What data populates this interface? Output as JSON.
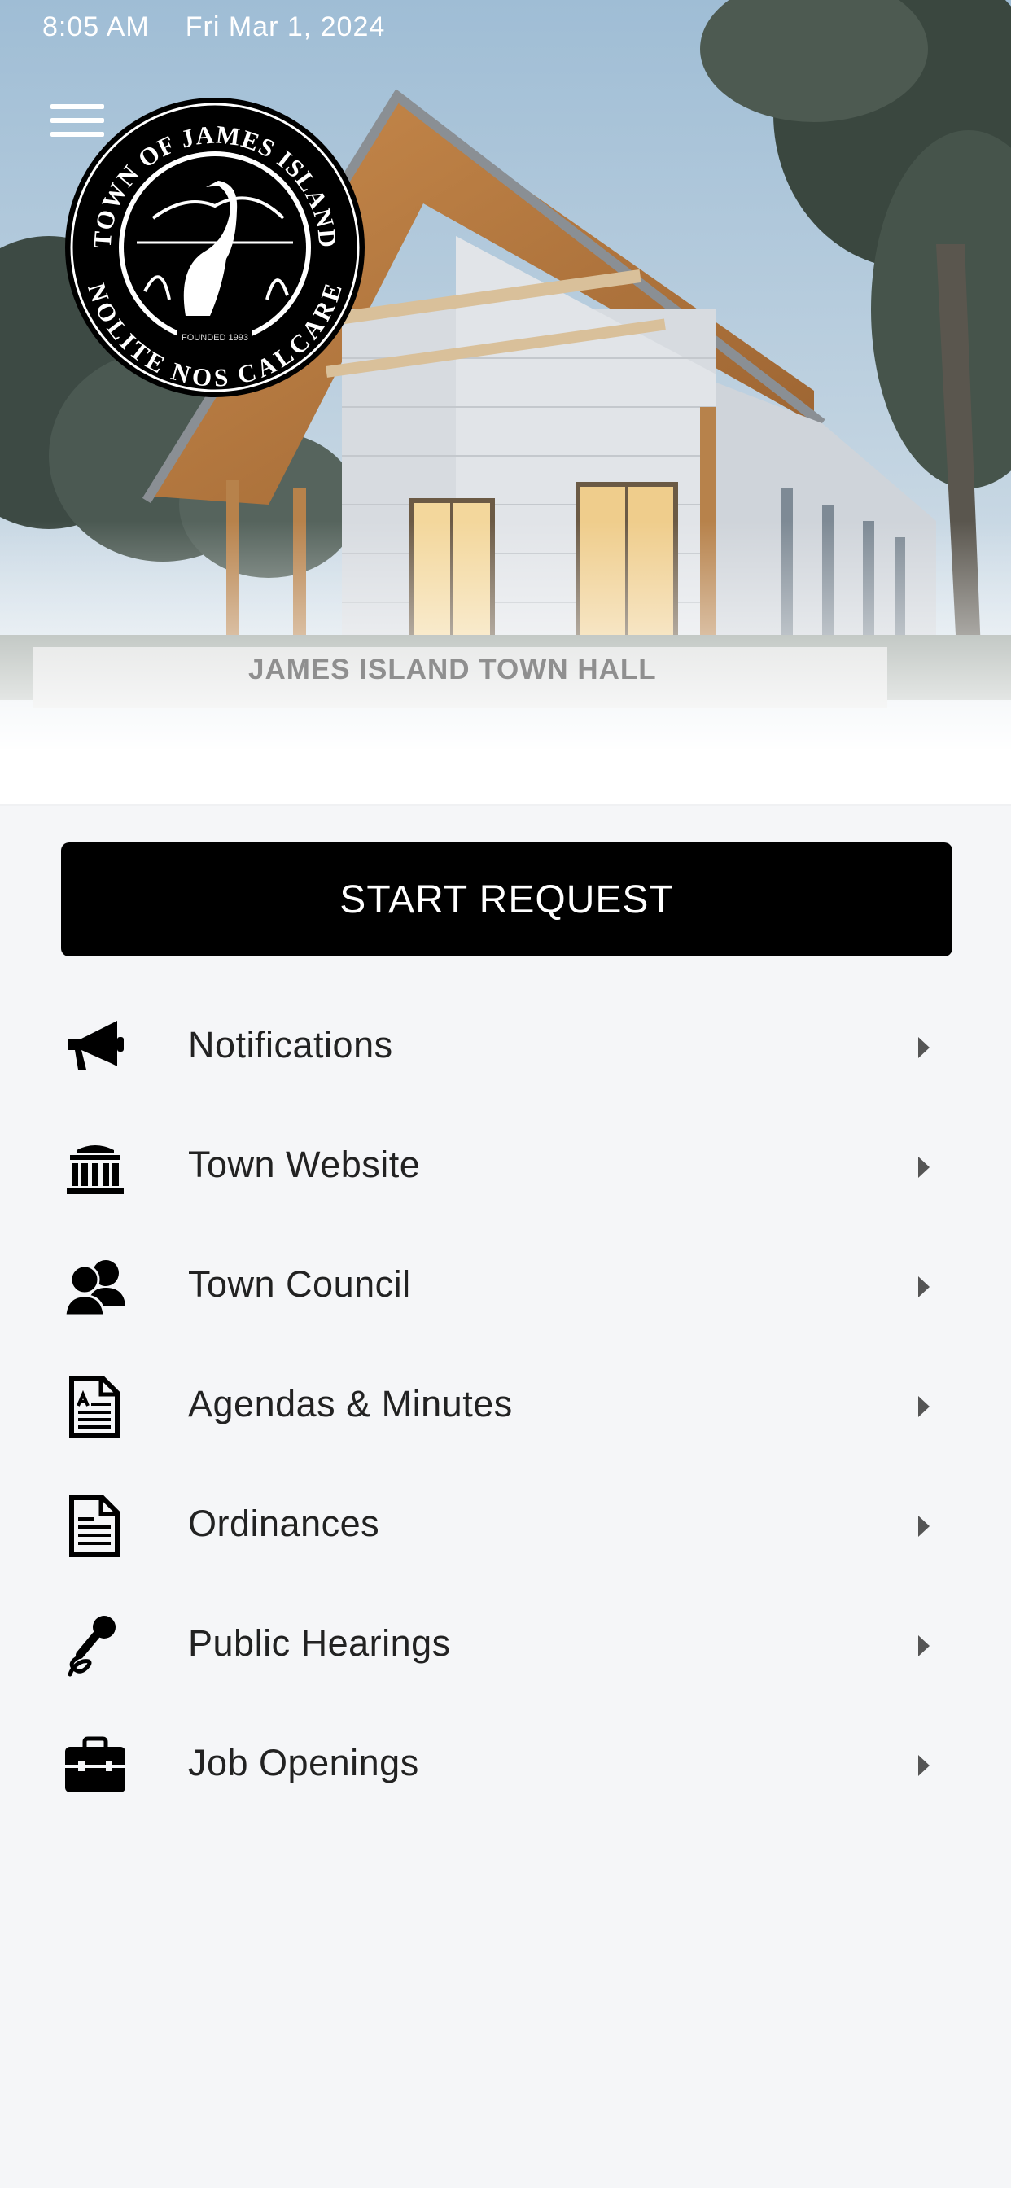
{
  "status_bar": {
    "time": "8:05 AM",
    "date": "Fri Mar 1, 2024"
  },
  "hero": {
    "seal_top_text": "TOWN OF JAMES ISLAND",
    "seal_bottom_text": "NOLITE NOS CALCARE",
    "seal_founded": "FOUNDED 1993",
    "building_sign": "JAMES ISLAND TOWN HALL"
  },
  "start_request": {
    "label": "START REQUEST"
  },
  "menu": [
    {
      "label": "Notifications",
      "icon": "megaphone-icon"
    },
    {
      "label": "Town Website",
      "icon": "building-icon"
    },
    {
      "label": "Town Council",
      "icon": "people-icon"
    },
    {
      "label": "Agendas & Minutes",
      "icon": "document-icon"
    },
    {
      "label": "Ordinances",
      "icon": "document-lines-icon"
    },
    {
      "label": "Public Hearings",
      "icon": "microphone-icon"
    },
    {
      "label": "Job Openings",
      "icon": "briefcase-icon"
    }
  ]
}
